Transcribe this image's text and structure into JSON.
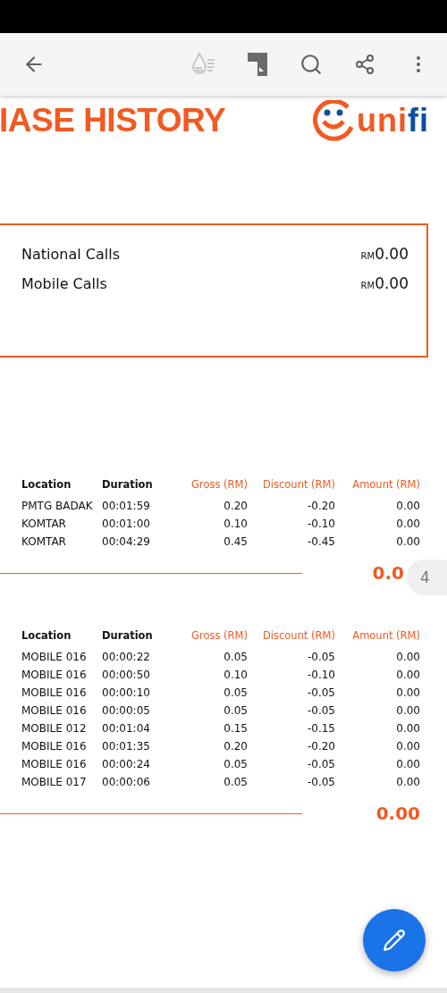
{
  "toolbar": {
    "actions": [
      {
        "kind": "reading-mode"
      },
      {
        "kind": "document"
      },
      {
        "kind": "search"
      },
      {
        "kind": "share"
      },
      {
        "kind": "more"
      }
    ]
  },
  "header": {
    "title": "IASE HISTORY",
    "logo": [
      {
        "text": "uni",
        "color": "#f15a22"
      },
      {
        "text": "fi",
        "color": "#0b4ea2"
      }
    ]
  },
  "summary": [
    {
      "label": "National Calls",
      "currency": "RM",
      "amount": "0.00"
    },
    {
      "label": "Mobile Calls",
      "currency": "RM",
      "amount": "0.00"
    }
  ],
  "tables": [
    {
      "columns": [
        "Location",
        "Duration",
        "Gross (RM)",
        "Discount (RM)",
        "Amount (RM)"
      ],
      "rows": [
        [
          "PMTG BADAK",
          "00:01:59",
          "0.20",
          "-0.20",
          "0.00"
        ],
        [
          "KOMTAR",
          "00:01:00",
          "0.10",
          "-0.10",
          "0.00"
        ],
        [
          "KOMTAR",
          "00:04:29",
          "0.45",
          "-0.45",
          "0.00"
        ]
      ],
      "total": "0.0"
    },
    {
      "columns": [
        "Location",
        "Duration",
        "Gross (RM)",
        "Discount (RM)",
        "Amount (RM)"
      ],
      "rows": [
        [
          "MOBILE 016",
          "00:00:22",
          "0.05",
          "-0.05",
          "0.00"
        ],
        [
          "MOBILE 016",
          "00:00:50",
          "0.10",
          "-0.10",
          "0.00"
        ],
        [
          "MOBILE 016",
          "00:00:10",
          "0.05",
          "-0.05",
          "0.00"
        ],
        [
          "MOBILE 016",
          "00:00:05",
          "0.05",
          "-0.05",
          "0.00"
        ],
        [
          "MOBILE 012",
          "00:01:04",
          "0.15",
          "-0.15",
          "0.00"
        ],
        [
          "MOBILE 016",
          "00:01:35",
          "0.20",
          "-0.20",
          "0.00"
        ],
        [
          "MOBILE 016",
          "00:00:24",
          "0.05",
          "-0.05",
          "0.00"
        ],
        [
          "MOBILE 017",
          "00:00:06",
          "0.05",
          "-0.05",
          "0.00"
        ]
      ],
      "total": "0.00"
    }
  ],
  "page_indicator": "4"
}
